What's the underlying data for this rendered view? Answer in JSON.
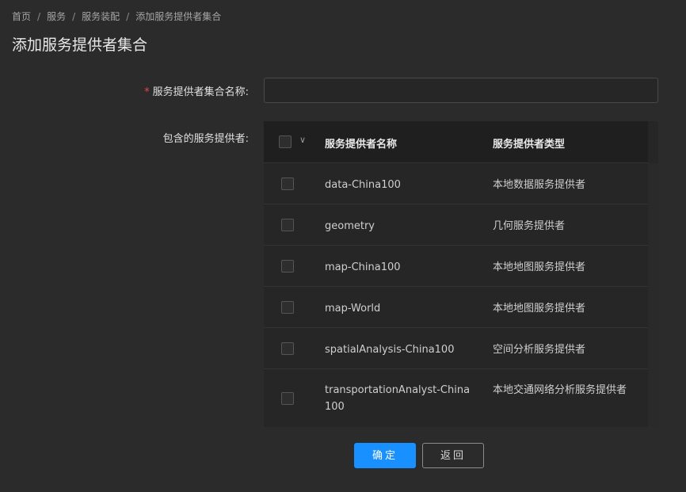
{
  "breadcrumb": {
    "items": [
      "首页",
      "服务",
      "服务装配"
    ],
    "current": "添加服务提供者集合",
    "separator": "/"
  },
  "page_title": "添加服务提供者集合",
  "form": {
    "name_label": "服务提供者集合名称:",
    "name_required_mark": "*",
    "name_value": "",
    "providers_label": "包含的服务提供者:"
  },
  "table": {
    "columns": [
      "服务提供者名称",
      "服务提供者类型"
    ],
    "caret_icon": "chevron-down-icon",
    "rows": [
      {
        "name": "data-China100",
        "type": "本地数据服务提供者"
      },
      {
        "name": "geometry",
        "type": "几何服务提供者"
      },
      {
        "name": "map-China100",
        "type": "本地地图服务提供者"
      },
      {
        "name": "map-World",
        "type": "本地地图服务提供者"
      },
      {
        "name": "spatialAnalysis-China100",
        "type": "空间分析服务提供者"
      },
      {
        "name": "transportationAnalyst-China100",
        "type": "本地交通网络分析服务提供者"
      }
    ]
  },
  "buttons": {
    "ok": "确定",
    "back": "返回"
  },
  "colors": {
    "primary": "#1890ff",
    "required": "#e84749",
    "background": "#2b2b2b"
  }
}
